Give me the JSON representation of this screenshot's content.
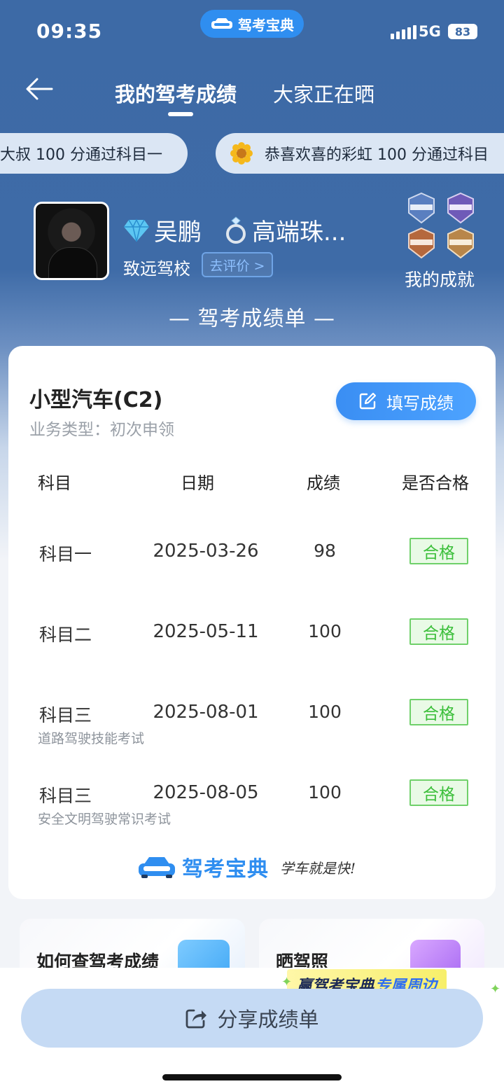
{
  "status_bar": {
    "time": "09:35",
    "app_badge": "驾考宝典",
    "network": "5G",
    "battery": "83"
  },
  "nav": {
    "tab_active": "我的驾考成绩",
    "tab_other": "大家正在晒"
  },
  "ticker": {
    "item1": "大叔 100 分通过科目一",
    "item2": "恭喜欢喜的彩虹 100 分通过科目"
  },
  "profile": {
    "name": "吴鹏",
    "title": "高端珠...",
    "school": "致远驾校",
    "evaluate": "去评价 >",
    "achievements_label": "我的成就"
  },
  "sheet_title": "— 驾考成绩单 —",
  "card": {
    "car_type": "小型汽车(C2)",
    "business_type": "业务类型：初次申领",
    "fill_button": "填写成绩",
    "headers": {
      "subject": "科目",
      "date": "日期",
      "score": "成绩",
      "pass": "是否合格"
    },
    "rows": [
      {
        "subject": "科目一",
        "date": "2025-03-26",
        "score": "98",
        "pass": "合格",
        "note": ""
      },
      {
        "subject": "科目二",
        "date": "2025-05-11",
        "score": "100",
        "pass": "合格",
        "note": ""
      },
      {
        "subject": "科目三",
        "date": "2025-08-01",
        "score": "100",
        "pass": "合格",
        "note": "道路驾驶技能考试"
      },
      {
        "subject": "科目三",
        "date": "2025-08-05",
        "score": "100",
        "pass": "合格",
        "note": "安全文明驾驶常识考试"
      }
    ],
    "brand": "驾考宝典",
    "slogan": "学车就是快!"
  },
  "bottom_cards": {
    "card1": "如何查驾考成绩",
    "card2": "晒驾照"
  },
  "promo": {
    "part1": "赢驾考宝典",
    "part2": "专属周边"
  },
  "share_button": "分享成绩单",
  "colors": {
    "hero_blue": "#3d6aa6",
    "primary": "#2f8ef0",
    "pass_green": "#3bbf3a"
  }
}
